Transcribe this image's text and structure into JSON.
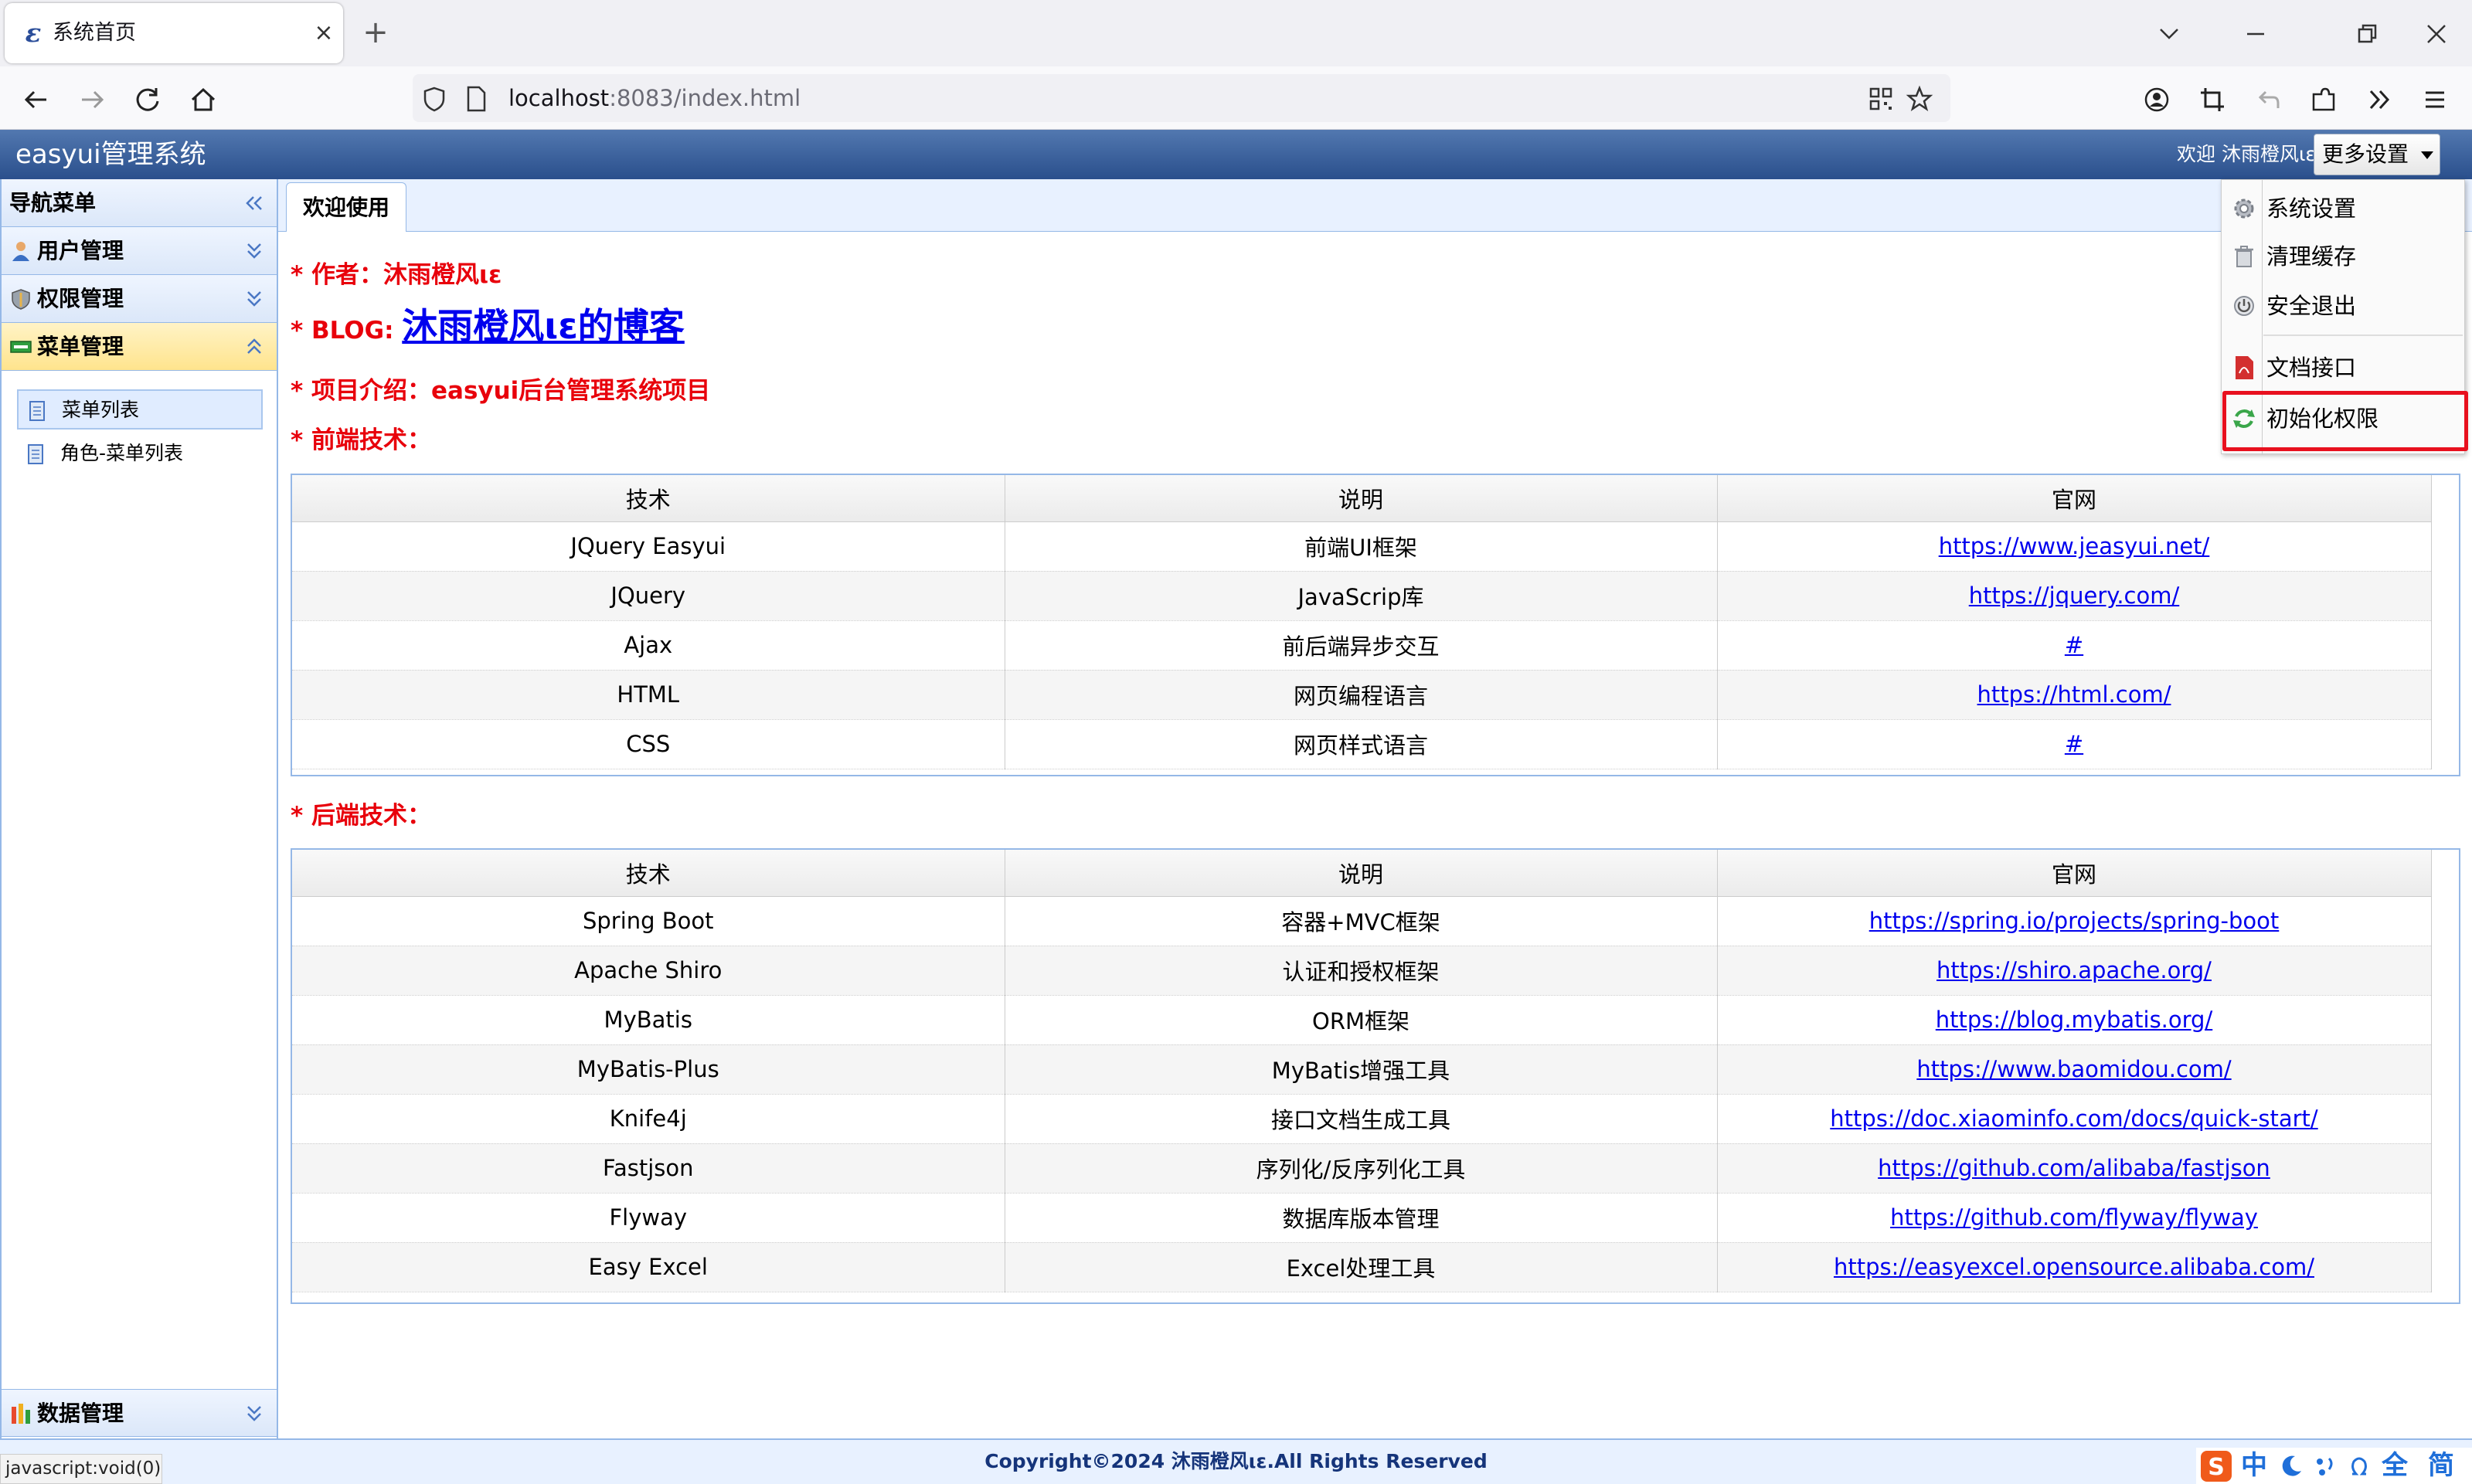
{
  "browser": {
    "tab_title": "系统首页",
    "tab_favicon": "ε",
    "url_host": "localhost",
    "url_rest": ":8083/index.html",
    "status_url": "javascript:void(0)"
  },
  "app": {
    "title": "easyui管理系统",
    "welcome": "欢迎 沐雨橙风ιε",
    "more_settings": "更多设置"
  },
  "sidebar": {
    "title": "导航菜单",
    "groups": [
      {
        "label": "用户管理"
      },
      {
        "label": "权限管理"
      },
      {
        "label": "菜单管理"
      },
      {
        "label": "数据管理"
      }
    ],
    "tree_items": [
      {
        "label": "菜单列表"
      },
      {
        "label": "角色-菜单列表"
      }
    ]
  },
  "main": {
    "tab_label": "欢迎使用",
    "author_label": "* 作者：沐雨橙风ιε",
    "blog_prefix": "* BLOG: ",
    "blog_link": "沐雨橙风ιε的博客",
    "project_intro": "* 项目介绍：easyui后台管理系统项目",
    "frontend_title": "* 前端技术：",
    "backend_title": "* 后端技术：",
    "columns": [
      "技术",
      "说明",
      "官网"
    ],
    "frontend_rows": [
      {
        "tech": "JQuery Easyui",
        "desc": "前端UI框架",
        "site": "https://www.jeasyui.net/"
      },
      {
        "tech": "JQuery",
        "desc": "JavaScrip库",
        "site": "https://jquery.com/"
      },
      {
        "tech": "Ajax",
        "desc": "前后端异步交互",
        "site": "#"
      },
      {
        "tech": "HTML",
        "desc": "网页编程语言",
        "site": "https://html.com/"
      },
      {
        "tech": "CSS",
        "desc": "网页样式语言",
        "site": "#"
      }
    ],
    "backend_rows": [
      {
        "tech": "Spring Boot",
        "desc": "容器+MVC框架",
        "site": "https://spring.io/projects/spring-boot"
      },
      {
        "tech": "Apache Shiro",
        "desc": "认证和授权框架",
        "site": "https://shiro.apache.org/"
      },
      {
        "tech": "MyBatis",
        "desc": "ORM框架",
        "site": "https://blog.mybatis.org/"
      },
      {
        "tech": "MyBatis-Plus",
        "desc": "MyBatis增强工具",
        "site": "https://www.baomidou.com/"
      },
      {
        "tech": "Knife4j",
        "desc": "接口文档生成工具",
        "site": "https://doc.xiaominfo.com/docs/quick-start/"
      },
      {
        "tech": "Fastjson",
        "desc": "序列化/反序列化工具",
        "site": "https://github.com/alibaba/fastjson"
      },
      {
        "tech": "Flyway",
        "desc": "数据库版本管理",
        "site": "https://github.com/flyway/flyway"
      },
      {
        "tech": "Easy Excel",
        "desc": "Excel处理工具",
        "site": "https://easyexcel.opensource.alibaba.com/"
      }
    ]
  },
  "menu": {
    "items": [
      {
        "label": "系统设置",
        "icon": "gear-icon"
      },
      {
        "label": "清理缓存",
        "icon": "trash-icon"
      },
      {
        "label": "安全退出",
        "icon": "power-icon"
      },
      {
        "label": "文档接口",
        "icon": "pdf-icon"
      },
      {
        "label": "初始化权限",
        "icon": "refresh-icon"
      }
    ]
  },
  "footer": {
    "copyright": "Copyright©2024 沐雨橙风ιε.All Rights Reserved"
  },
  "ime": {
    "chars": [
      "中",
      "全",
      "简"
    ]
  },
  "colors": {
    "header_blue": "#2a4f8c",
    "accent_red": "#e8000b",
    "link_blue": "#0000ee",
    "selected_yellow": "#ffe48d"
  }
}
